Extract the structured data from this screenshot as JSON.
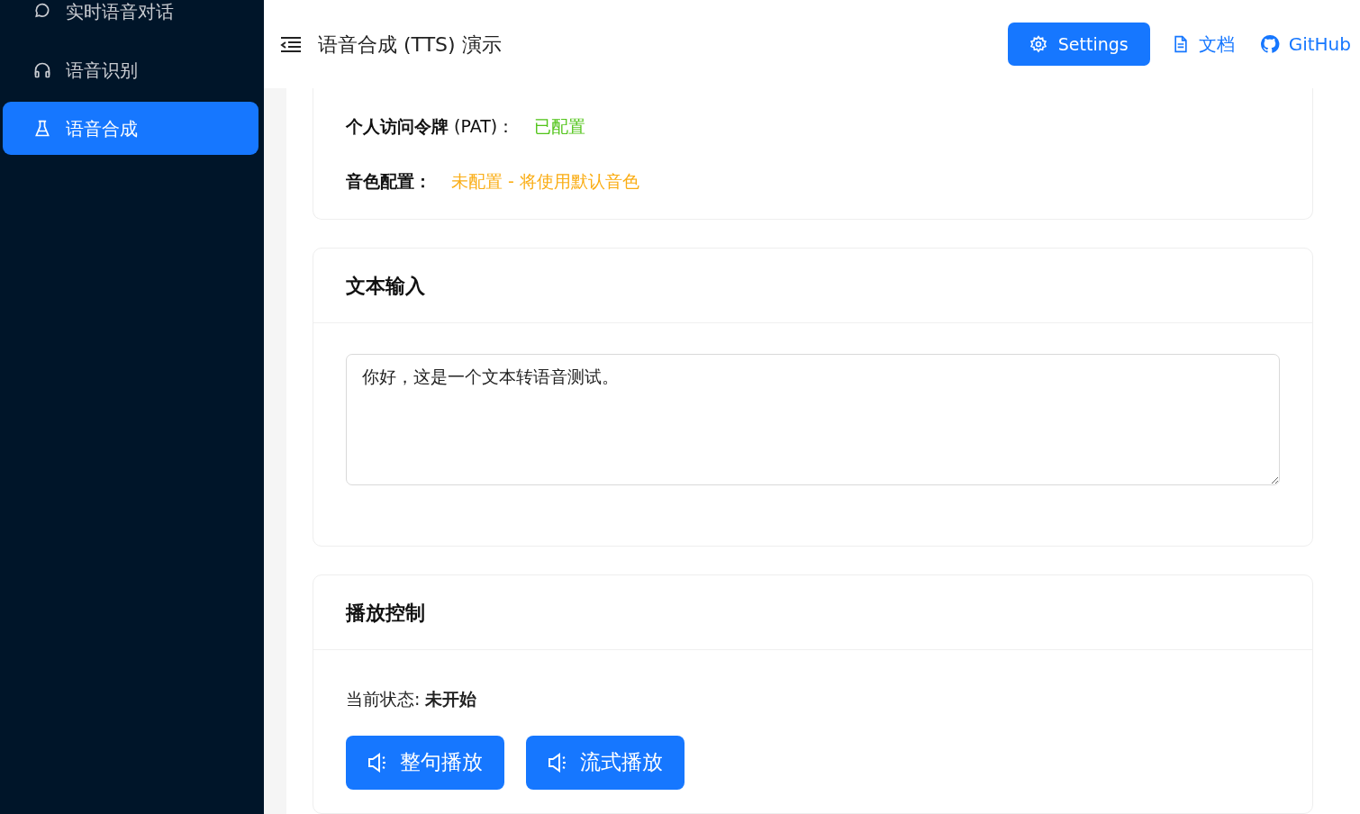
{
  "sidebar": {
    "items": [
      {
        "label": "实时语音对话",
        "selected": false
      },
      {
        "label": "语音识别",
        "selected": false
      },
      {
        "label": "语音合成",
        "selected": true
      }
    ]
  },
  "header": {
    "title": "语音合成 (TTS) 演示",
    "settings_button": "Settings",
    "links": [
      {
        "label": "文档"
      },
      {
        "label": "GitHub"
      }
    ]
  },
  "config_card": {
    "rows": [
      {
        "label": "**个人访问令牌** (PAT)：",
        "value": "已配置",
        "color": "#52c41a"
      },
      {
        "label": "**音色配置：**",
        "value": "未配置 - 将使用默认音色",
        "color": "#faad14"
      }
    ]
  },
  "text_card": {
    "title": "文本输入",
    "value": "你好，这是一个文本转语音测试。"
  },
  "playback_card": {
    "title": "播放控制",
    "status": "当前状态: **未开始**",
    "buttons": [
      "整句播放",
      "流式播放"
    ]
  }
}
